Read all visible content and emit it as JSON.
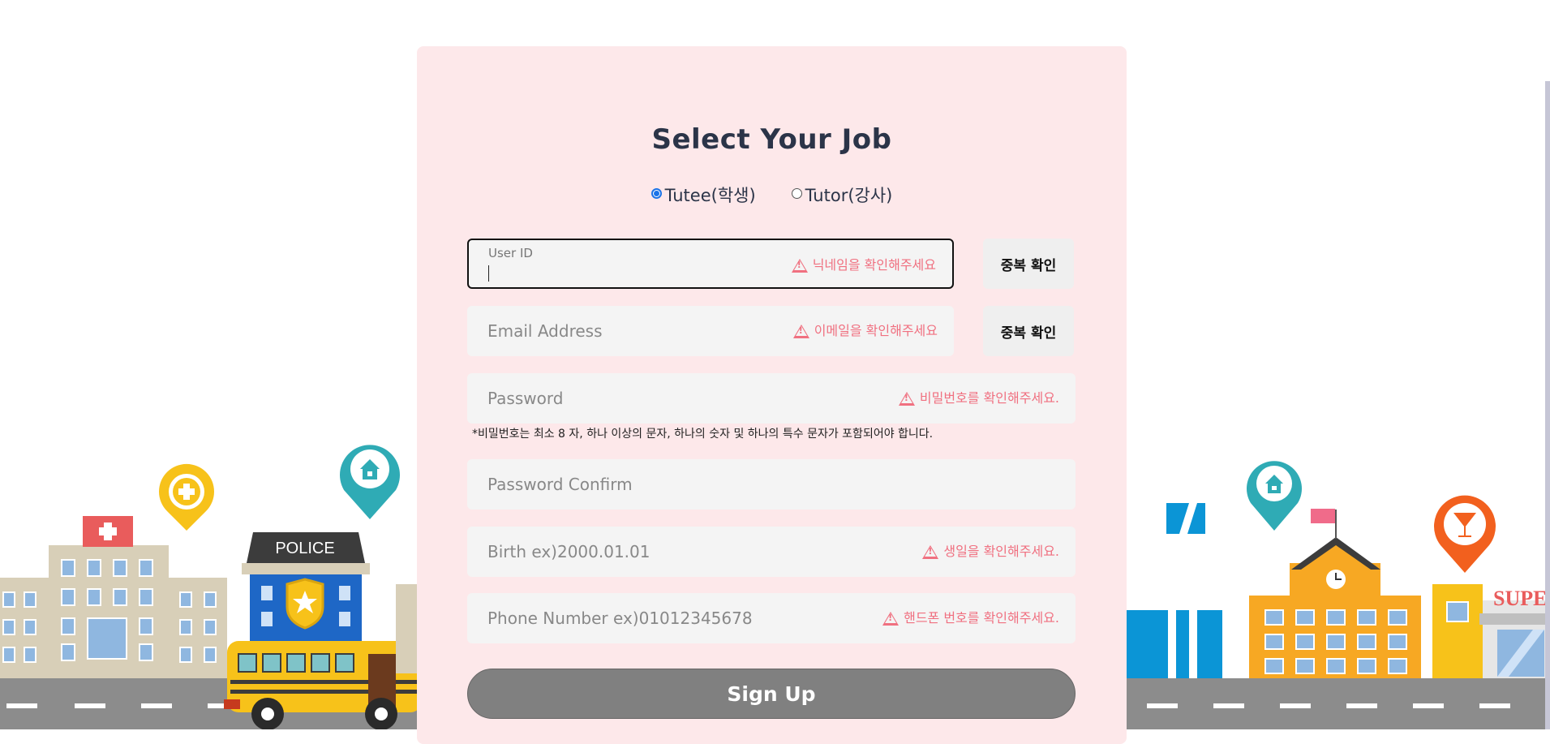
{
  "form": {
    "title": "Select Your Job",
    "roles": [
      {
        "label": "Tutee(학생)",
        "checked": true
      },
      {
        "label": "Tutor(강사)",
        "checked": false
      }
    ],
    "user_id": {
      "label": "User ID",
      "value": "",
      "error": "닉네임을 확인해주세요",
      "button": "중복 확인"
    },
    "email": {
      "placeholder": "Email Address",
      "error": "이메일을 확인해주세요",
      "button": "중복 확인"
    },
    "password": {
      "placeholder": "Password",
      "error": "비밀번호를 확인해주세요.",
      "hint": "*비밀번호는 최소 8 자, 하나 이상의 문자, 하나의 숫자 및 하나의 특수 문자가 포함되어야 합니다."
    },
    "password_confirm": {
      "placeholder": "Password Confirm"
    },
    "birth": {
      "placeholder": "Birth ex)2000.01.01",
      "error": "생일을 확인해주세요."
    },
    "phone": {
      "placeholder": "Phone Number ex)01012345678",
      "error": "핸드폰 번호를 확인해주세요."
    },
    "submit": "Sign Up"
  },
  "scene": {
    "police_sign": "POLICE",
    "shop_sign": "SUPE"
  },
  "colors": {
    "card_bg": "#fde8ea",
    "title": "#2b3448",
    "error": "#f07080",
    "button_gray": "#808080",
    "radio_accent": "#1a73e8"
  },
  "icons": [
    "warning-icon",
    "hospital-cross-icon",
    "house-pin-icon",
    "police-badge-icon",
    "cocktail-pin-icon"
  ]
}
